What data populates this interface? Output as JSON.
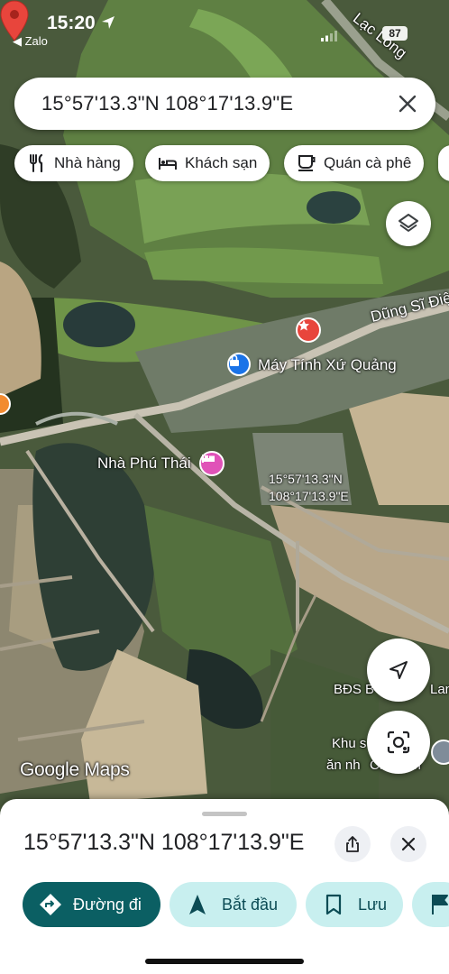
{
  "status_bar": {
    "time": "15:20",
    "back_app": "◀ Zalo",
    "battery": "87"
  },
  "search": {
    "query": "15°57'13.3\"N 108°17'13.9\"E"
  },
  "chips": [
    {
      "label": "Nhà hàng",
      "icon": "utensils-icon"
    },
    {
      "label": "Khách sạn",
      "icon": "bed-icon"
    },
    {
      "label": "Quán cà phê",
      "icon": "coffee-icon"
    }
  ],
  "map": {
    "labels": {
      "road_north": "Lạc Long",
      "road_east": "Dũng Sĩ Điện",
      "poi_computer": "Máy Tính Xứ Quảng",
      "poi_hotel": "Nhà Phú Thái",
      "poi_bds": "BĐS B",
      "poi_bds_suffix": "Lan",
      "poi_khu": "Khu s",
      "poi_khu_line2": "ăn nh",
      "poi_khu_suffix": "Ch",
      "poi_khu_tail": "em"
    },
    "pin_label": [
      "15°57'13.3\"N",
      "108°17'13.9\"E"
    ],
    "watermark": "Google Maps"
  },
  "sheet": {
    "title": "15°57'13.3\"N 108°17'13.9\"E",
    "actions": [
      {
        "label": "Đường đi",
        "icon": "directions-icon"
      },
      {
        "label": "Bắt đầu",
        "icon": "navigation-arrow-icon"
      },
      {
        "label": "Lưu",
        "icon": "bookmark-icon"
      }
    ]
  },
  "colors": {
    "primary_button": "#0b5f63",
    "secondary_button": "#c8efef",
    "pin": "#e8453c"
  }
}
